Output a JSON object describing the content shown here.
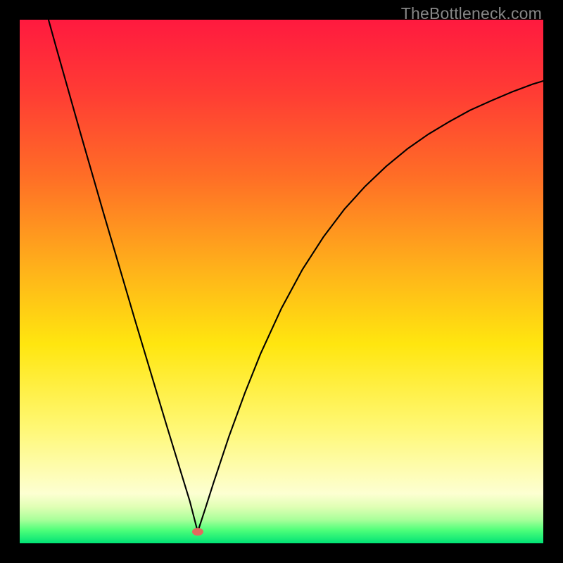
{
  "watermark": "TheBottleneck.com",
  "chart_data": {
    "type": "line",
    "title": "",
    "xlabel": "",
    "ylabel": "",
    "xlim": [
      0,
      1
    ],
    "ylim": [
      0,
      1
    ],
    "grid": false,
    "legend": false,
    "annotations": [],
    "background_gradient": {
      "stops": [
        {
          "pos": 0.0,
          "color": "#ff1a3f"
        },
        {
          "pos": 0.14,
          "color": "#ff3c34"
        },
        {
          "pos": 0.3,
          "color": "#ff6e26"
        },
        {
          "pos": 0.48,
          "color": "#ffb31a"
        },
        {
          "pos": 0.62,
          "color": "#ffe60f"
        },
        {
          "pos": 0.78,
          "color": "#fff875"
        },
        {
          "pos": 0.905,
          "color": "#fdffd2"
        },
        {
          "pos": 0.93,
          "color": "#e1ffb5"
        },
        {
          "pos": 0.955,
          "color": "#a9ff9a"
        },
        {
          "pos": 0.975,
          "color": "#4eff7a"
        },
        {
          "pos": 1.0,
          "color": "#00e275"
        }
      ]
    },
    "marker": {
      "x": 0.34,
      "y": 0.978,
      "color": "#e26a5e"
    },
    "series": [
      {
        "name": "curve",
        "color": "#000000",
        "x": [
          0.055,
          0.07,
          0.085,
          0.1,
          0.115,
          0.13,
          0.145,
          0.16,
          0.175,
          0.19,
          0.205,
          0.22,
          0.235,
          0.25,
          0.265,
          0.28,
          0.295,
          0.31,
          0.325,
          0.34,
          0.355,
          0.37,
          0.4,
          0.43,
          0.46,
          0.5,
          0.54,
          0.58,
          0.62,
          0.66,
          0.7,
          0.74,
          0.78,
          0.82,
          0.86,
          0.9,
          0.94,
          0.98,
          1.0
        ],
        "y": [
          0.0,
          0.054,
          0.107,
          0.16,
          0.213,
          0.265,
          0.317,
          0.369,
          0.42,
          0.471,
          0.522,
          0.573,
          0.623,
          0.673,
          0.723,
          0.773,
          0.822,
          0.871,
          0.92,
          0.978,
          0.932,
          0.885,
          0.795,
          0.713,
          0.638,
          0.551,
          0.477,
          0.415,
          0.362,
          0.318,
          0.28,
          0.247,
          0.219,
          0.195,
          0.173,
          0.155,
          0.138,
          0.123,
          0.117
        ]
      }
    ]
  }
}
